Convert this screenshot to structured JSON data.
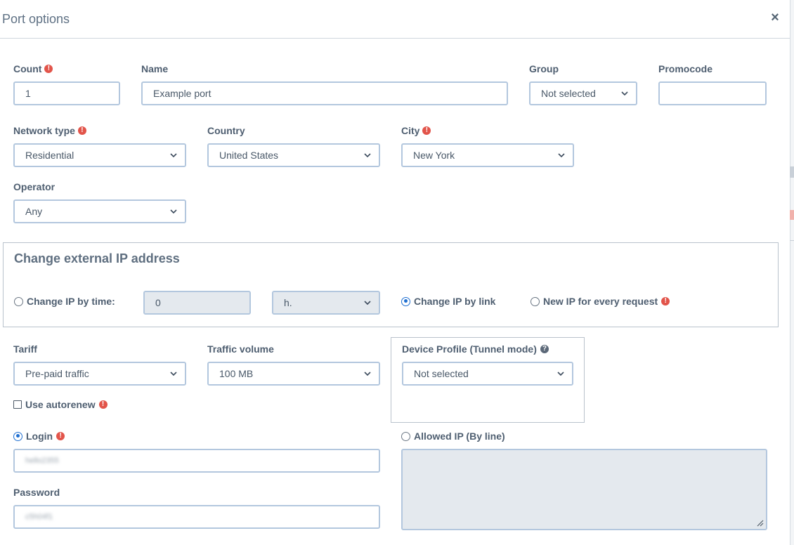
{
  "dialog": {
    "title": "Port options",
    "close_symbol": "×"
  },
  "fields": {
    "count": {
      "label": "Count",
      "value": "1"
    },
    "name": {
      "label": "Name",
      "value": "Example port"
    },
    "group": {
      "label": "Group",
      "value": "Not selected"
    },
    "promocode": {
      "label": "Promocode",
      "value": ""
    },
    "network_type": {
      "label": "Network type",
      "value": "Residential"
    },
    "country": {
      "label": "Country",
      "value": "United States"
    },
    "city": {
      "label": "City",
      "value": "New York"
    },
    "operator": {
      "label": "Operator",
      "value": "Any"
    }
  },
  "ip_change": {
    "title": "Change external IP address",
    "by_time": {
      "label": "Change IP by time:",
      "selected": false,
      "value": "0",
      "unit": "h."
    },
    "by_link": {
      "label": "Change IP by link",
      "selected": true
    },
    "every_request": {
      "label": "New IP for every request",
      "selected": false
    }
  },
  "tariff": {
    "label": "Tariff",
    "value": "Pre-paid traffic",
    "autorenew_label": "Use autorenew",
    "autorenew_checked": false
  },
  "traffic_volume": {
    "label": "Traffic volume",
    "value": "100 MB"
  },
  "device_profile": {
    "label": "Device Profile (Tunnel mode)",
    "value": "Not selected"
  },
  "auth": {
    "login": {
      "label": "Login",
      "selected": true,
      "value": "hello2355"
    },
    "password": {
      "label": "Password",
      "value": "c5h04f1"
    },
    "allowed_ip": {
      "label": "Allowed IP (By line)",
      "selected": false,
      "value": ""
    }
  },
  "icons": {
    "warning": "!",
    "help": "?"
  },
  "colors": {
    "accent": "#1f6fd1",
    "warning": "#e2544a",
    "border": "#b3c7de"
  }
}
